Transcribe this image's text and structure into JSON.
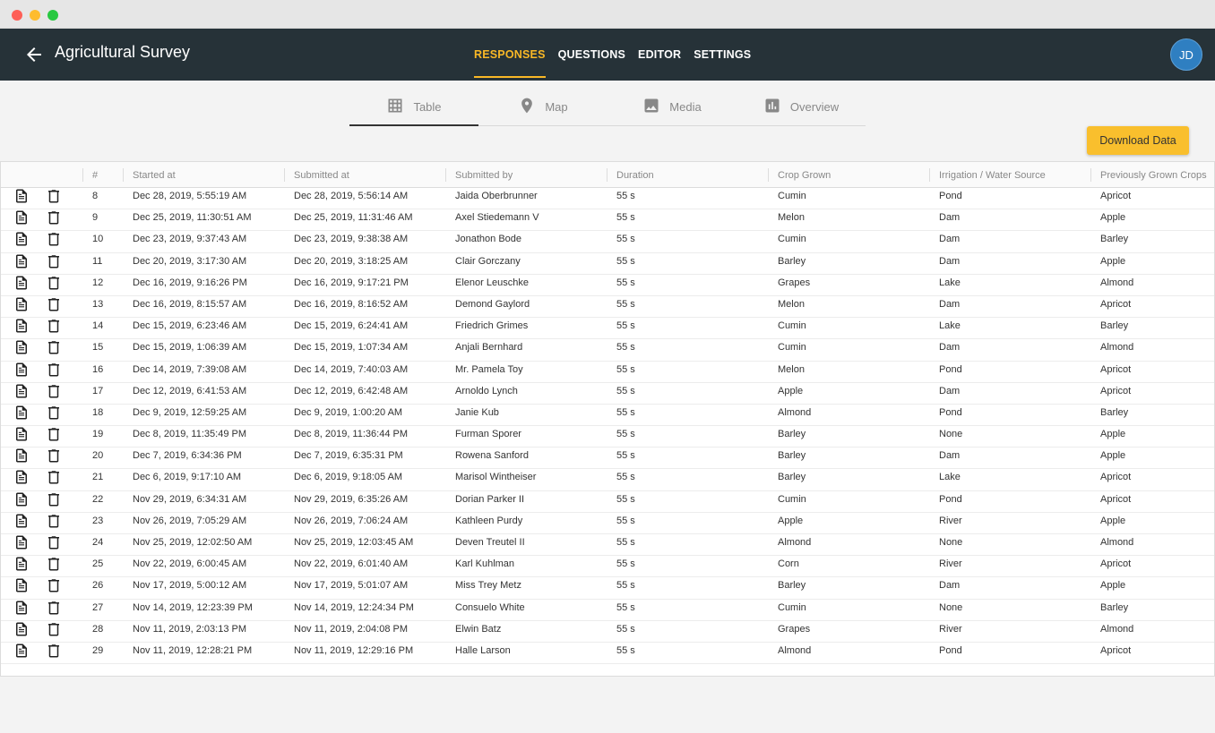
{
  "app": {
    "title": "Agricultural Survey",
    "user_initials": "JD"
  },
  "nav": [
    {
      "label": "RESPONSES",
      "active": true
    },
    {
      "label": "QUESTIONS",
      "active": false
    },
    {
      "label": "EDITOR",
      "active": false
    },
    {
      "label": "SETTINGS",
      "active": false
    }
  ],
  "tabs": [
    {
      "label": "Table",
      "icon": "grid-icon",
      "active": true
    },
    {
      "label": "Map",
      "icon": "map-pin-icon",
      "active": false
    },
    {
      "label": "Media",
      "icon": "image-icon",
      "active": false
    },
    {
      "label": "Overview",
      "icon": "bar-chart-icon",
      "active": false
    }
  ],
  "download_label": "Download Data",
  "columns": [
    "#",
    "Started at",
    "Submitted at",
    "Submitted by",
    "Duration",
    "Crop Grown",
    "Irrigation / Water Source",
    "Previously Grown Crops"
  ],
  "rows": [
    [
      "8",
      "Dec 28, 2019, 5:55:19 AM",
      "Dec 28, 2019, 5:56:14 AM",
      "Jaida Oberbrunner",
      "55 s",
      "Cumin",
      "Pond",
      "Apricot"
    ],
    [
      "9",
      "Dec 25, 2019, 11:30:51 AM",
      "Dec 25, 2019, 11:31:46 AM",
      "Axel Stiedemann V",
      "55 s",
      "Melon",
      "Dam",
      "Apple"
    ],
    [
      "10",
      "Dec 23, 2019, 9:37:43 AM",
      "Dec 23, 2019, 9:38:38 AM",
      "Jonathon Bode",
      "55 s",
      "Cumin",
      "Dam",
      "Barley"
    ],
    [
      "11",
      "Dec 20, 2019, 3:17:30 AM",
      "Dec 20, 2019, 3:18:25 AM",
      "Clair Gorczany",
      "55 s",
      "Barley",
      "Dam",
      "Apple"
    ],
    [
      "12",
      "Dec 16, 2019, 9:16:26 PM",
      "Dec 16, 2019, 9:17:21 PM",
      "Elenor Leuschke",
      "55 s",
      "Grapes",
      "Lake",
      "Almond"
    ],
    [
      "13",
      "Dec 16, 2019, 8:15:57 AM",
      "Dec 16, 2019, 8:16:52 AM",
      "Demond Gaylord",
      "55 s",
      "Melon",
      "Dam",
      "Apricot"
    ],
    [
      "14",
      "Dec 15, 2019, 6:23:46 AM",
      "Dec 15, 2019, 6:24:41 AM",
      "Friedrich Grimes",
      "55 s",
      "Cumin",
      "Lake",
      "Barley"
    ],
    [
      "15",
      "Dec 15, 2019, 1:06:39 AM",
      "Dec 15, 2019, 1:07:34 AM",
      "Anjali Bernhard",
      "55 s",
      "Cumin",
      "Dam",
      "Almond"
    ],
    [
      "16",
      "Dec 14, 2019, 7:39:08 AM",
      "Dec 14, 2019, 7:40:03 AM",
      "Mr. Pamela Toy",
      "55 s",
      "Melon",
      "Pond",
      "Apricot"
    ],
    [
      "17",
      "Dec 12, 2019, 6:41:53 AM",
      "Dec 12, 2019, 6:42:48 AM",
      "Arnoldo Lynch",
      "55 s",
      "Apple",
      "Dam",
      "Apricot"
    ],
    [
      "18",
      "Dec 9, 2019, 12:59:25 AM",
      "Dec 9, 2019, 1:00:20 AM",
      "Janie Kub",
      "55 s",
      "Almond",
      "Pond",
      "Barley"
    ],
    [
      "19",
      "Dec 8, 2019, 11:35:49 PM",
      "Dec 8, 2019, 11:36:44 PM",
      "Furman Sporer",
      "55 s",
      "Barley",
      "None",
      "Apple"
    ],
    [
      "20",
      "Dec 7, 2019, 6:34:36 PM",
      "Dec 7, 2019, 6:35:31 PM",
      "Rowena Sanford",
      "55 s",
      "Barley",
      "Dam",
      "Apple"
    ],
    [
      "21",
      "Dec 6, 2019, 9:17:10 AM",
      "Dec 6, 2019, 9:18:05 AM",
      "Marisol Wintheiser",
      "55 s",
      "Barley",
      "Lake",
      "Apricot"
    ],
    [
      "22",
      "Nov 29, 2019, 6:34:31 AM",
      "Nov 29, 2019, 6:35:26 AM",
      "Dorian Parker II",
      "55 s",
      "Cumin",
      "Pond",
      "Apricot"
    ],
    [
      "23",
      "Nov 26, 2019, 7:05:29 AM",
      "Nov 26, 2019, 7:06:24 AM",
      "Kathleen Purdy",
      "55 s",
      "Apple",
      "River",
      "Apple"
    ],
    [
      "24",
      "Nov 25, 2019, 12:02:50 AM",
      "Nov 25, 2019, 12:03:45 AM",
      "Deven Treutel II",
      "55 s",
      "Almond",
      "None",
      "Almond"
    ],
    [
      "25",
      "Nov 22, 2019, 6:00:45 AM",
      "Nov 22, 2019, 6:01:40 AM",
      "Karl Kuhlman",
      "55 s",
      "Corn",
      "River",
      "Apricot"
    ],
    [
      "26",
      "Nov 17, 2019, 5:00:12 AM",
      "Nov 17, 2019, 5:01:07 AM",
      "Miss Trey Metz",
      "55 s",
      "Barley",
      "Dam",
      "Apple"
    ],
    [
      "27",
      "Nov 14, 2019, 12:23:39 PM",
      "Nov 14, 2019, 12:24:34 PM",
      "Consuelo White",
      "55 s",
      "Cumin",
      "None",
      "Barley"
    ],
    [
      "28",
      "Nov 11, 2019, 2:03:13 PM",
      "Nov 11, 2019, 2:04:08 PM",
      "Elwin Batz",
      "55 s",
      "Grapes",
      "River",
      "Almond"
    ],
    [
      "29",
      "Nov 11, 2019, 12:28:21 PM",
      "Nov 11, 2019, 12:29:16 PM",
      "Halle Larson",
      "55 s",
      "Almond",
      "Pond",
      "Apricot"
    ]
  ],
  "colors": {
    "appbar": "#263238",
    "accent": "#f9b826",
    "avatar": "#2f7fc1",
    "button": "#f9bf2d"
  }
}
